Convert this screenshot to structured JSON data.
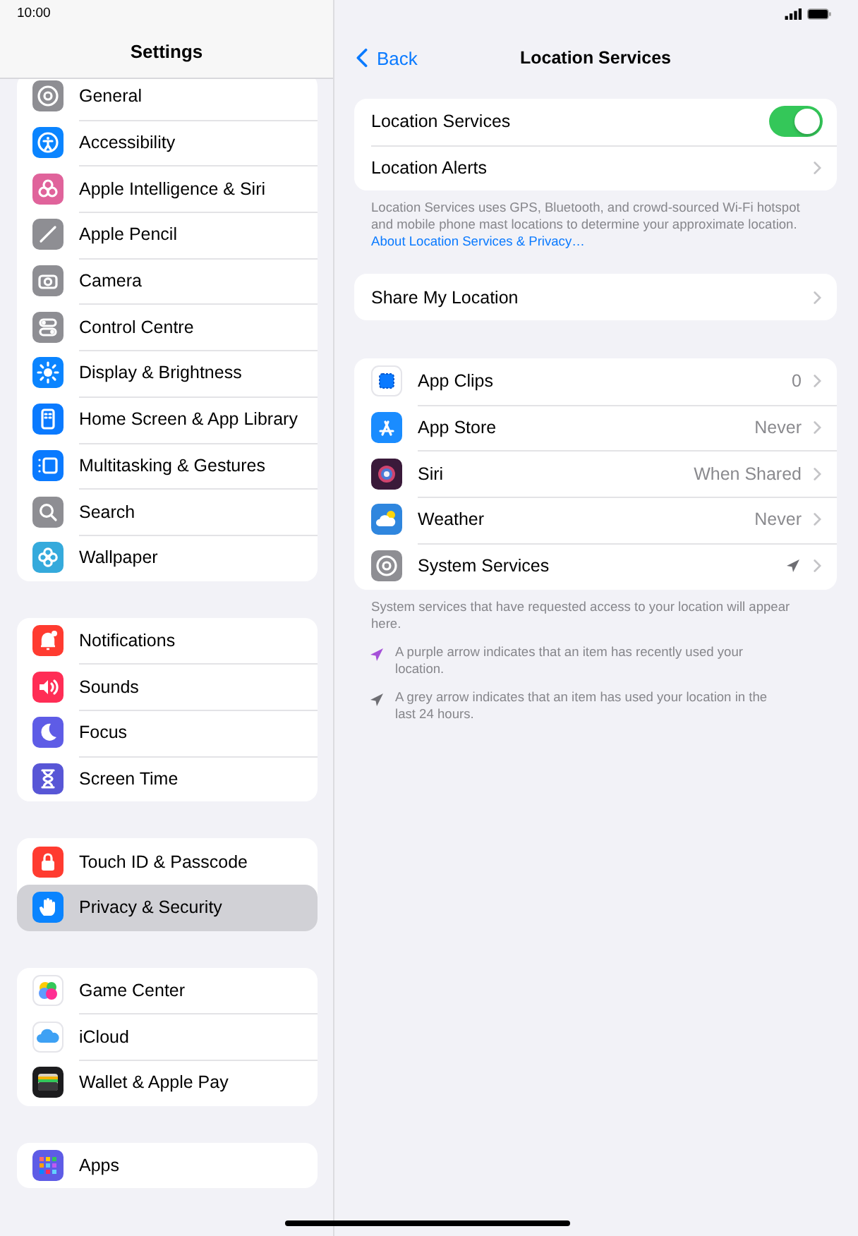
{
  "status_bar": {
    "time": "10:00"
  },
  "sidebar": {
    "title": "Settings",
    "groups": [
      {
        "items": [
          {
            "label": "General",
            "color": "#8e8e93",
            "selected": false
          },
          {
            "label": "Accessibility",
            "color": "#0a84ff",
            "selected": false
          },
          {
            "label": "Apple Intelligence & Siri",
            "color": "#e0639b",
            "selected": false
          },
          {
            "label": "Apple Pencil",
            "color": "#8e8e93",
            "selected": false
          },
          {
            "label": "Camera",
            "color": "#8e8e93",
            "selected": false
          },
          {
            "label": "Control Centre",
            "color": "#8e8e93",
            "selected": false
          },
          {
            "label": "Display & Brightness",
            "color": "#0a84ff",
            "selected": false
          },
          {
            "label": "Home Screen & App Library",
            "color": "#0a7aff",
            "selected": false
          },
          {
            "label": "Multitasking & Gestures",
            "color": "#0a7aff",
            "selected": false
          },
          {
            "label": "Search",
            "color": "#8e8e93",
            "selected": false
          },
          {
            "label": "Wallpaper",
            "color": "#35aadc",
            "selected": false
          }
        ]
      },
      {
        "items": [
          {
            "label": "Notifications",
            "color": "#ff3b30",
            "selected": false
          },
          {
            "label": "Sounds",
            "color": "#ff2d55",
            "selected": false
          },
          {
            "label": "Focus",
            "color": "#5e5ce6",
            "selected": false
          },
          {
            "label": "Screen Time",
            "color": "#5856d6",
            "selected": false
          }
        ]
      },
      {
        "items": [
          {
            "label": "Touch ID & Passcode",
            "color": "#ff3b30",
            "selected": false
          },
          {
            "label": "Privacy & Security",
            "color": "#0a84ff",
            "selected": true
          }
        ]
      },
      {
        "items": [
          {
            "label": "Game Center",
            "color": "#ffffff",
            "selected": false
          },
          {
            "label": "iCloud",
            "color": "#ffffff",
            "selected": false
          },
          {
            "label": "Wallet & Apple Pay",
            "color": "#1c1c1e",
            "selected": false
          }
        ]
      },
      {
        "items": [
          {
            "label": "Apps",
            "color": "#5e5ce6",
            "selected": false
          }
        ]
      }
    ]
  },
  "detail": {
    "back": "Back",
    "title": "Location Services",
    "main_group": [
      {
        "label": "Location Services",
        "kind": "toggle",
        "on": true
      },
      {
        "label": "Location Alerts",
        "kind": "link"
      }
    ],
    "main_footer": {
      "text": "Location Services uses GPS, Bluetooth, and crowd-sourced Wi-Fi hotspot and mobile phone mast locations to determine your approximate location. ",
      "link": "About Location Services & Privacy…"
    },
    "share": {
      "label": "Share My Location"
    },
    "apps": [
      {
        "label": "App Clips",
        "kind": "text",
        "value": "0",
        "color": "#ffffff"
      },
      {
        "label": "App Store",
        "kind": "text",
        "value": "Never",
        "color": "#1a8cff"
      },
      {
        "label": "Siri",
        "kind": "text",
        "value": "When Shared",
        "color": "#3a1a3a"
      },
      {
        "label": "Weather",
        "kind": "text",
        "value": "Never",
        "color": "#2f86de"
      },
      {
        "label": "System Services",
        "kind": "arrow",
        "color": "#8e8e93"
      }
    ],
    "apps_footer": "System services that have requested access to your location will appear here.",
    "legend": [
      {
        "text": "A purple arrow indicates that an item has recently used your location.",
        "color": "#a550d8"
      },
      {
        "text": "A grey arrow indicates that an item has used your location in the last 24 hours.",
        "color": "#6e6e73"
      }
    ]
  }
}
